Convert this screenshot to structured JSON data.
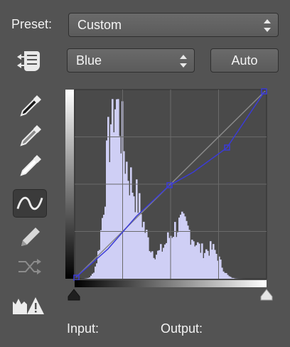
{
  "preset": {
    "label": "Preset:",
    "value": "Custom"
  },
  "channel": {
    "value": "Blue"
  },
  "auto_button": {
    "label": "Auto"
  },
  "footer": {
    "input_label": "Input:",
    "output_label": "Output:"
  },
  "colors": {
    "panel_bg": "#535353",
    "graph_bg": "#4a4a4a",
    "histogram": "#cfcff5",
    "curve": "#3b3bd6"
  }
}
